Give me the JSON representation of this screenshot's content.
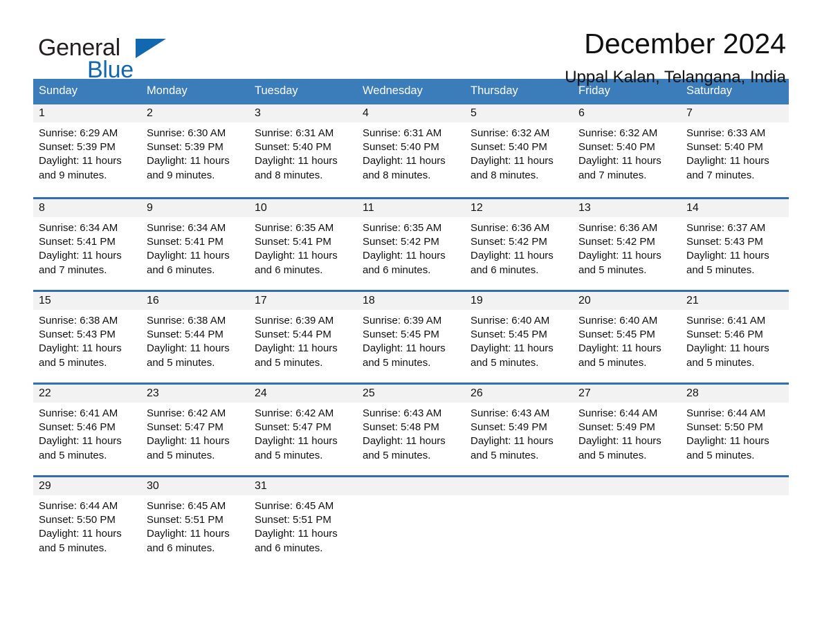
{
  "logo": {
    "word_one": "General",
    "word_two": "Blue",
    "triangle_icon": "triangle-icon",
    "brand_color": "#1267b1"
  },
  "header": {
    "title": "December 2024",
    "subtitle": "Uppal Kalan, Telangana, India"
  },
  "colors": {
    "header_blue": "#3b7cbb",
    "row_divider_blue": "#2f6fb0",
    "daynum_strip": "#f2f2f2",
    "text": "#111111"
  },
  "weekdays": [
    "Sunday",
    "Monday",
    "Tuesday",
    "Wednesday",
    "Thursday",
    "Friday",
    "Saturday"
  ],
  "weeks": [
    [
      {
        "day": "1",
        "sunrise": "Sunrise: 6:29 AM",
        "sunset": "Sunset: 5:39 PM",
        "daylight": "Daylight: 11 hours and 9 minutes."
      },
      {
        "day": "2",
        "sunrise": "Sunrise: 6:30 AM",
        "sunset": "Sunset: 5:39 PM",
        "daylight": "Daylight: 11 hours and 9 minutes."
      },
      {
        "day": "3",
        "sunrise": "Sunrise: 6:31 AM",
        "sunset": "Sunset: 5:40 PM",
        "daylight": "Daylight: 11 hours and 8 minutes."
      },
      {
        "day": "4",
        "sunrise": "Sunrise: 6:31 AM",
        "sunset": "Sunset: 5:40 PM",
        "daylight": "Daylight: 11 hours and 8 minutes."
      },
      {
        "day": "5",
        "sunrise": "Sunrise: 6:32 AM",
        "sunset": "Sunset: 5:40 PM",
        "daylight": "Daylight: 11 hours and 8 minutes."
      },
      {
        "day": "6",
        "sunrise": "Sunrise: 6:32 AM",
        "sunset": "Sunset: 5:40 PM",
        "daylight": "Daylight: 11 hours and 7 minutes."
      },
      {
        "day": "7",
        "sunrise": "Sunrise: 6:33 AM",
        "sunset": "Sunset: 5:40 PM",
        "daylight": "Daylight: 11 hours and 7 minutes."
      }
    ],
    [
      {
        "day": "8",
        "sunrise": "Sunrise: 6:34 AM",
        "sunset": "Sunset: 5:41 PM",
        "daylight": "Daylight: 11 hours and 7 minutes."
      },
      {
        "day": "9",
        "sunrise": "Sunrise: 6:34 AM",
        "sunset": "Sunset: 5:41 PM",
        "daylight": "Daylight: 11 hours and 6 minutes."
      },
      {
        "day": "10",
        "sunrise": "Sunrise: 6:35 AM",
        "sunset": "Sunset: 5:41 PM",
        "daylight": "Daylight: 11 hours and 6 minutes."
      },
      {
        "day": "11",
        "sunrise": "Sunrise: 6:35 AM",
        "sunset": "Sunset: 5:42 PM",
        "daylight": "Daylight: 11 hours and 6 minutes."
      },
      {
        "day": "12",
        "sunrise": "Sunrise: 6:36 AM",
        "sunset": "Sunset: 5:42 PM",
        "daylight": "Daylight: 11 hours and 6 minutes."
      },
      {
        "day": "13",
        "sunrise": "Sunrise: 6:36 AM",
        "sunset": "Sunset: 5:42 PM",
        "daylight": "Daylight: 11 hours and 5 minutes."
      },
      {
        "day": "14",
        "sunrise": "Sunrise: 6:37 AM",
        "sunset": "Sunset: 5:43 PM",
        "daylight": "Daylight: 11 hours and 5 minutes."
      }
    ],
    [
      {
        "day": "15",
        "sunrise": "Sunrise: 6:38 AM",
        "sunset": "Sunset: 5:43 PM",
        "daylight": "Daylight: 11 hours and 5 minutes."
      },
      {
        "day": "16",
        "sunrise": "Sunrise: 6:38 AM",
        "sunset": "Sunset: 5:44 PM",
        "daylight": "Daylight: 11 hours and 5 minutes."
      },
      {
        "day": "17",
        "sunrise": "Sunrise: 6:39 AM",
        "sunset": "Sunset: 5:44 PM",
        "daylight": "Daylight: 11 hours and 5 minutes."
      },
      {
        "day": "18",
        "sunrise": "Sunrise: 6:39 AM",
        "sunset": "Sunset: 5:45 PM",
        "daylight": "Daylight: 11 hours and 5 minutes."
      },
      {
        "day": "19",
        "sunrise": "Sunrise: 6:40 AM",
        "sunset": "Sunset: 5:45 PM",
        "daylight": "Daylight: 11 hours and 5 minutes."
      },
      {
        "day": "20",
        "sunrise": "Sunrise: 6:40 AM",
        "sunset": "Sunset: 5:45 PM",
        "daylight": "Daylight: 11 hours and 5 minutes."
      },
      {
        "day": "21",
        "sunrise": "Sunrise: 6:41 AM",
        "sunset": "Sunset: 5:46 PM",
        "daylight": "Daylight: 11 hours and 5 minutes."
      }
    ],
    [
      {
        "day": "22",
        "sunrise": "Sunrise: 6:41 AM",
        "sunset": "Sunset: 5:46 PM",
        "daylight": "Daylight: 11 hours and 5 minutes."
      },
      {
        "day": "23",
        "sunrise": "Sunrise: 6:42 AM",
        "sunset": "Sunset: 5:47 PM",
        "daylight": "Daylight: 11 hours and 5 minutes."
      },
      {
        "day": "24",
        "sunrise": "Sunrise: 6:42 AM",
        "sunset": "Sunset: 5:47 PM",
        "daylight": "Daylight: 11 hours and 5 minutes."
      },
      {
        "day": "25",
        "sunrise": "Sunrise: 6:43 AM",
        "sunset": "Sunset: 5:48 PM",
        "daylight": "Daylight: 11 hours and 5 minutes."
      },
      {
        "day": "26",
        "sunrise": "Sunrise: 6:43 AM",
        "sunset": "Sunset: 5:49 PM",
        "daylight": "Daylight: 11 hours and 5 minutes."
      },
      {
        "day": "27",
        "sunrise": "Sunrise: 6:44 AM",
        "sunset": "Sunset: 5:49 PM",
        "daylight": "Daylight: 11 hours and 5 minutes."
      },
      {
        "day": "28",
        "sunrise": "Sunrise: 6:44 AM",
        "sunset": "Sunset: 5:50 PM",
        "daylight": "Daylight: 11 hours and 5 minutes."
      }
    ],
    [
      {
        "day": "29",
        "sunrise": "Sunrise: 6:44 AM",
        "sunset": "Sunset: 5:50 PM",
        "daylight": "Daylight: 11 hours and 5 minutes."
      },
      {
        "day": "30",
        "sunrise": "Sunrise: 6:45 AM",
        "sunset": "Sunset: 5:51 PM",
        "daylight": "Daylight: 11 hours and 6 minutes."
      },
      {
        "day": "31",
        "sunrise": "Sunrise: 6:45 AM",
        "sunset": "Sunset: 5:51 PM",
        "daylight": "Daylight: 11 hours and 6 minutes."
      },
      {
        "day": "",
        "sunrise": "",
        "sunset": "",
        "daylight": ""
      },
      {
        "day": "",
        "sunrise": "",
        "sunset": "",
        "daylight": ""
      },
      {
        "day": "",
        "sunrise": "",
        "sunset": "",
        "daylight": ""
      },
      {
        "day": "",
        "sunrise": "",
        "sunset": "",
        "daylight": ""
      }
    ]
  ]
}
